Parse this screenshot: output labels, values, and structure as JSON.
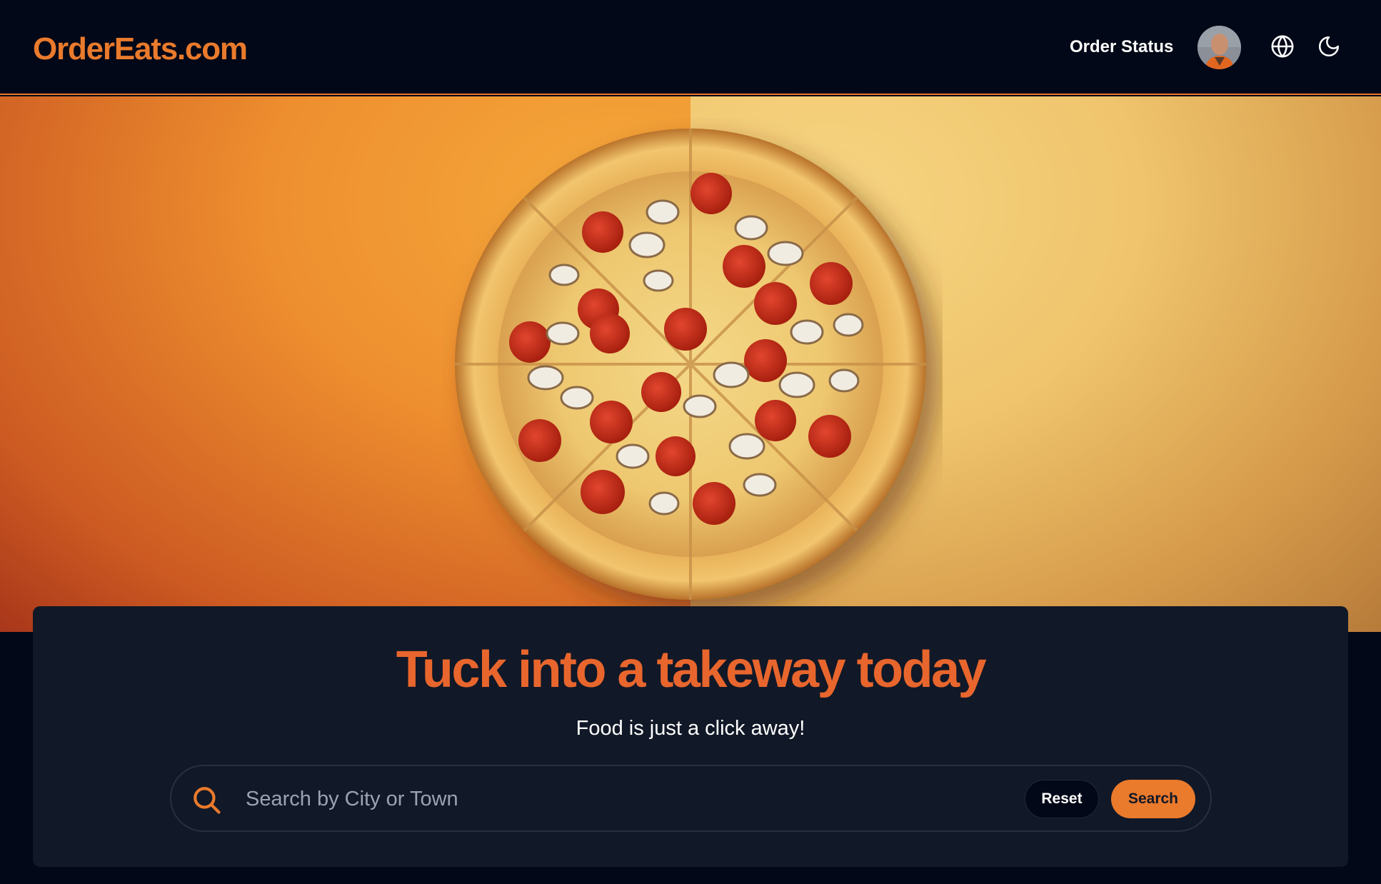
{
  "header": {
    "brand": "OrderEats.com",
    "order_status_label": "Order Status",
    "avatar": "user-avatar",
    "icons": [
      "globe-icon",
      "moon-icon"
    ]
  },
  "hero": {
    "image": "pizza-image"
  },
  "search_card": {
    "headline": "Tuck into a takeway today",
    "subheadline": "Food is just a click away!",
    "search_placeholder": "Search by City or Town",
    "search_value": "",
    "reset_label": "Reset",
    "search_label": "Search"
  },
  "colors": {
    "accent": "#ea7a2c",
    "headline": "#e8662d",
    "background": "#020817",
    "card": "#111827"
  }
}
